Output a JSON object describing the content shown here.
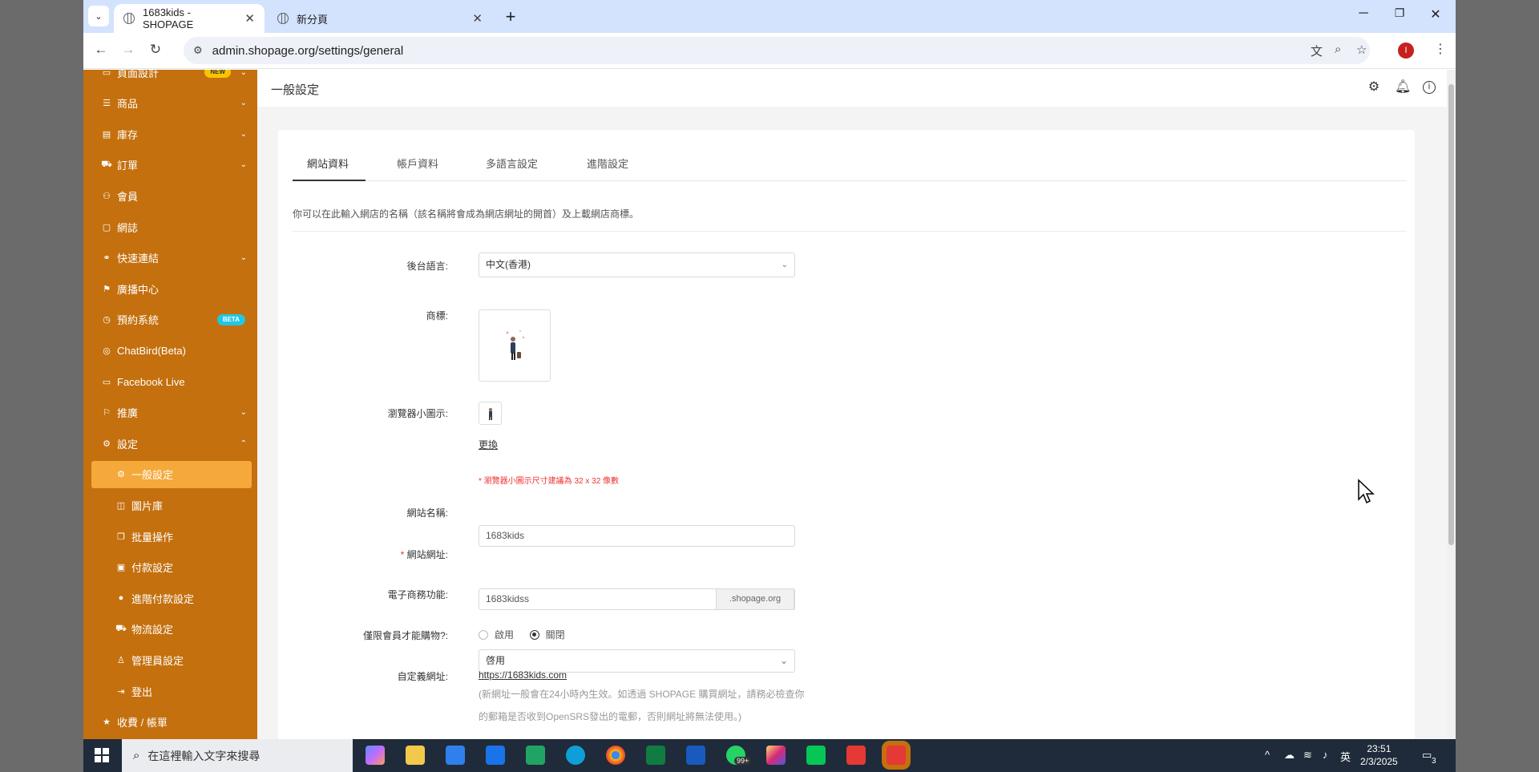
{
  "browser": {
    "tabs": [
      {
        "title": "1683kids - SHOPAGE",
        "active": true
      },
      {
        "title": "新分頁",
        "active": false
      }
    ],
    "url": "admin.shopage.org/settings/general",
    "profile_initial": "I"
  },
  "sidebar": {
    "items": [
      {
        "label": "頁面設計",
        "icon": "layout-icon",
        "badge": "NEW",
        "chevron": true
      },
      {
        "label": "商品",
        "icon": "list-icon",
        "chevron": true
      },
      {
        "label": "庫存",
        "icon": "warehouse-icon",
        "chevron": true
      },
      {
        "label": "訂單",
        "icon": "cart-icon",
        "chevron": true
      },
      {
        "label": "會員",
        "icon": "members-icon"
      },
      {
        "label": "網誌",
        "icon": "blog-icon"
      },
      {
        "label": "快速連結",
        "icon": "link-icon",
        "chevron": true
      },
      {
        "label": "廣播中心",
        "icon": "broadcast-icon"
      },
      {
        "label": "預約系統",
        "icon": "clock-icon",
        "badge": "BETA"
      },
      {
        "label": "ChatBird(Beta)",
        "icon": "globe-icon"
      },
      {
        "label": "Facebook Live",
        "icon": "video-icon"
      },
      {
        "label": "推廣",
        "icon": "flag-icon",
        "chevron": true
      },
      {
        "label": "設定",
        "icon": "settings-icon",
        "chevron": true,
        "expanded": true
      },
      {
        "label": "一般設定",
        "icon": "settings-icon",
        "sub": true,
        "active": true
      },
      {
        "label": "圖片庫",
        "icon": "camera-icon",
        "sub": true
      },
      {
        "label": "批量操作",
        "icon": "copy-icon",
        "sub": true
      },
      {
        "label": "付款設定",
        "icon": "payment-icon",
        "sub": true
      },
      {
        "label": "進階付款設定",
        "icon": "dollar-icon",
        "sub": true
      },
      {
        "label": "物流設定",
        "icon": "truck-icon",
        "sub": true
      },
      {
        "label": "管理員設定",
        "icon": "user-icon",
        "sub": true
      },
      {
        "label": "登出",
        "icon": "logout-icon",
        "sub": true
      },
      {
        "label": "收費 / 帳單",
        "icon": "star-icon"
      }
    ]
  },
  "header": {
    "title": "一般設定"
  },
  "page_tabs": [
    "網站資料",
    "帳戶資料",
    "多語言設定",
    "進階設定"
  ],
  "intro": "你可以在此輸入網店的名稱（該名稱將會成為網店網址的開首）及上載網店商標。",
  "form": {
    "admin_language_label": "後台語言:",
    "admin_language_value": "中文(香港)",
    "logo_label": "商標:",
    "favicon_label": "瀏覽器小圖示:",
    "change_link": "更換",
    "favicon_hint": "* 瀏覽器小圖示尺寸建議為 32 x 32 像數",
    "site_name_label": "網站名稱:",
    "site_name_value": "1683kids",
    "site_url_req": "* ",
    "site_url_label": "網站網址:",
    "site_url_value": "1683kidss",
    "site_url_suffix": ".shopage.org",
    "ecommerce_label": "電子商務功能:",
    "ecommerce_value": "啓用",
    "members_only_label": "僅限會員才能購物?:",
    "members_only_options": [
      "啟用",
      "關閉"
    ],
    "members_only_selected": "關閉",
    "custom_domain_label": "自定義網址:",
    "custom_domain_value": "https://1683kids.com",
    "custom_domain_note_1": "(新網址一般會在24小時內生效。如透過 SHOPAGE 購買網址，請務必檢查你",
    "custom_domain_note_2": "的郵箱是否收到OpenSRS發出的電郵，否則網址將無法使用。)"
  },
  "taskbar": {
    "search_placeholder": "在這裡輸入文字來搜尋",
    "ime": "英",
    "time": "23:51",
    "date": "2/3/2025",
    "notifications": "3",
    "whatsapp_badge": "99+"
  },
  "colors": {
    "sidebar": "#c4700e",
    "sidebar_active": "#f6a93b",
    "tabbar": "#d3e3fd",
    "taskbar": "#1f2b3a"
  }
}
